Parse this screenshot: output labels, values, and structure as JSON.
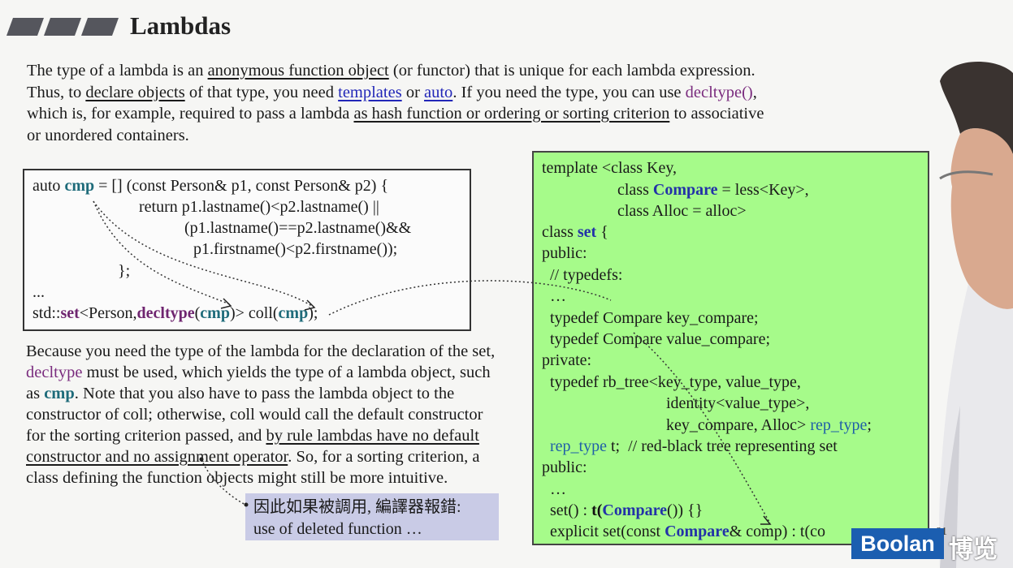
{
  "slide": {
    "title": "Lambdas",
    "intro": {
      "t1": "The type of a lambda is an ",
      "u1": "anonymous function object",
      "t2": " (or functor) that is unique for each lambda expression. Thus, to ",
      "u2": "declare objects",
      "t3": " of that type, you need ",
      "k1": "templates",
      "t4": " or ",
      "k2": "auto",
      "t5": ". If you need the type, you can use ",
      "k3": "decltype()",
      "t6": ", which is, for example, required to pass a lambda ",
      "u3": "as hash function or ordering or sorting criterion",
      "t7": " to associative or unordered containers."
    },
    "code_left": {
      "l1a": "auto ",
      "l1b": "cmp",
      "l1c": " = [] (const Person& p1, const Person& p2) {",
      "l2": "return p1.lastname()<p2.lastname() ||",
      "l3": "(p1.lastname()==p2.lastname()&&",
      "l4": "p1.firstname()<p2.firstname());",
      "l5": "};",
      "l6": "...",
      "l7a": "std::",
      "l7b": "set",
      "l7c": "<Person,",
      "l7d": "decltype",
      "l7e": "(",
      "l7f": "cmp",
      "l7g": ")> coll(",
      "l7h": "cmp",
      "l7i": ");"
    },
    "para2": {
      "t1": "Because you need the type of the lambda for the declaration of the set, ",
      "k1": "decltype",
      "t2": " must be used, which yields the type of a lambda object, such as ",
      "k2": "cmp",
      "t3": ". Note that you also have to pass the lambda object to the constructor of coll; otherwise, coll would call the default constructor for the sorting criterion passed, and ",
      "u1": "by rule lambdas have no default constructor and no assignment operator",
      "t4": ". So, for a sorting criterion, a class defining the function objects might still be more intuitive."
    },
    "note": {
      "line1": "因此如果被調用, 編譯器報錯:",
      "line2": "use of deleted function …"
    },
    "code_right": {
      "l1": "template <class Key,",
      "l2a": "class ",
      "l2b": "Compare",
      "l2c": " = less<Key>,",
      "l3": "class Alloc = alloc>",
      "l4a": "class ",
      "l4b": "set",
      "l4c": " {",
      "l5": "public:",
      "l6": "// typedefs:",
      "l7": "…",
      "l8": "typedef Compare key_compare;",
      "l9": "typedef Compare value_compare;",
      "l10": "private:",
      "l11": "typedef rb_tree<key_type, value_type,",
      "l12": "identity<value_type>,",
      "l13a": "key_compare, Alloc> ",
      "l13b": "rep_type",
      "l13c": ";",
      "l14a": "rep_type",
      "l14b": " t;  // red-black tree representing set",
      "l15": "public:",
      "l16": "…",
      "l17a": "set() : ",
      "l17b": "t(",
      "l17c": "Compare",
      "l17d": "()) {}",
      "l18a": "explicit set(const ",
      "l18b": "Compare",
      "l18c": "& comp) : t(co"
    },
    "page_number": "81",
    "logo_text": "Boolan",
    "logo_cn": "博览",
    "colors": {
      "green_box": "#a6fb8a",
      "note_bg": "#c9cbe6",
      "keyword_blue": "#2227b8",
      "keyword_purple": "#7a2c7e",
      "teal": "#1e6b7a"
    }
  }
}
